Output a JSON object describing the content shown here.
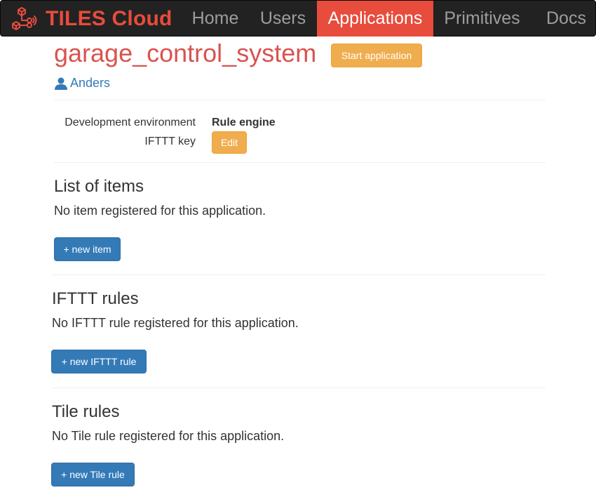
{
  "navbar": {
    "brand": "TILES Cloud",
    "brand_color": "#e74c3c",
    "items": [
      {
        "label": "Home",
        "active": false
      },
      {
        "label": "Users",
        "active": false
      },
      {
        "label": "Applications",
        "active": true
      },
      {
        "label": "Primitives",
        "active": false
      },
      {
        "label": "Docs",
        "active": false
      }
    ]
  },
  "app": {
    "name": "garage_control_system",
    "start_button": "Start application",
    "owner": "Anders",
    "owner_icon": "user-icon"
  },
  "details": {
    "env_label": "Development environment",
    "env_value": "Rule engine",
    "ifttt_key_label": "IFTTT key",
    "edit_button": "Edit"
  },
  "items_section": {
    "heading": "List of items",
    "empty_text": "No item registered for this application.",
    "add_button": "+ new item"
  },
  "ifttt_section": {
    "heading": "IFTTT rules",
    "empty_text": "No IFTTT rule registered for this application.",
    "add_button": "+ new IFTTT rule"
  },
  "tile_section": {
    "heading": "Tile rules",
    "empty_text": "No Tile rule registered for this application.",
    "add_button": "+ new Tile rule"
  },
  "colors": {
    "title": "#d9534f",
    "link": "#337ab7",
    "warning": "#f0ad4e",
    "primary": "#337ab7",
    "navbar_bg": "#222222"
  }
}
